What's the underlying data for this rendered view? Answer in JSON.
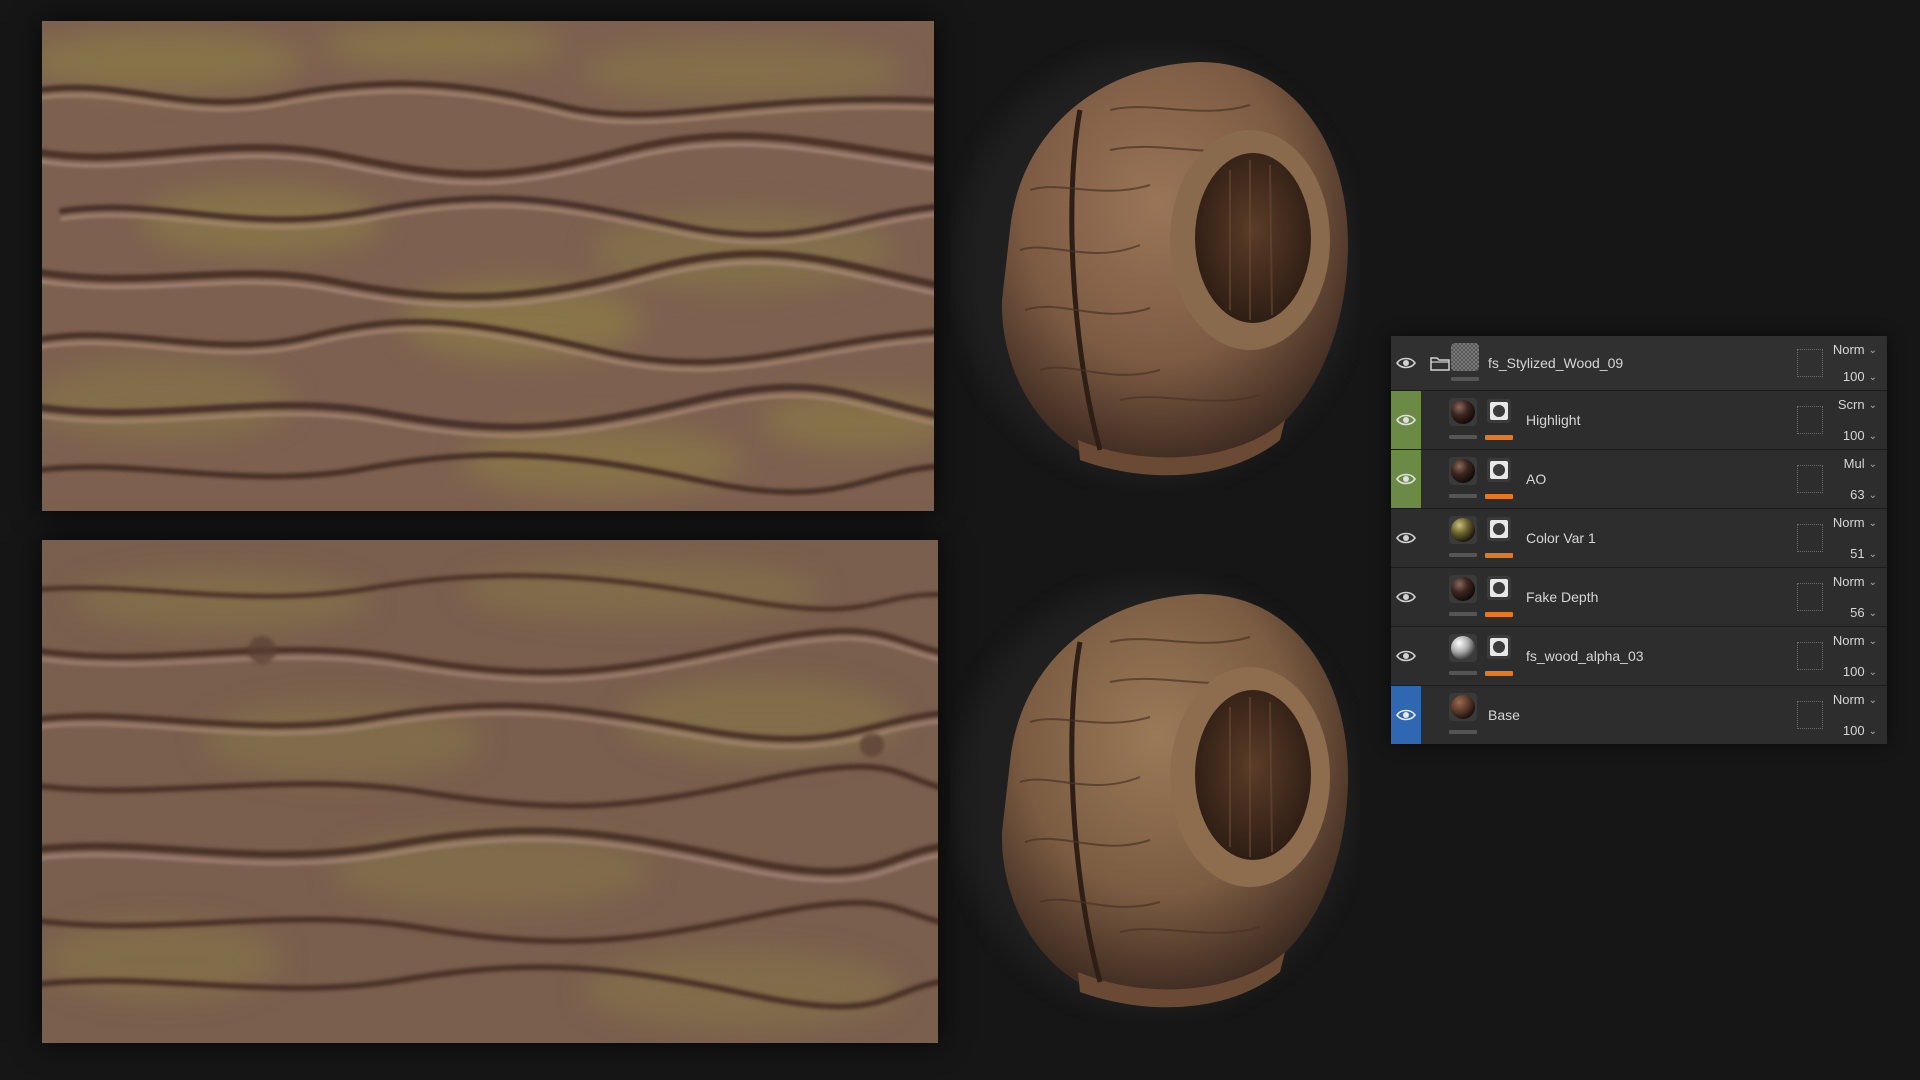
{
  "colors": {
    "panel_bg": "#2d2d2d",
    "active_green": "#6b8a45",
    "active_blue": "#2f67b3",
    "mask_bar_orange": "#e8761a",
    "wood_base": "#7b5f4f",
    "moss": "#7f7a3c"
  },
  "layers": [
    {
      "name": "fs_Stylized_Wood_09",
      "blend": "Norm",
      "opacity": "100",
      "type": "folder",
      "strip": "none",
      "thumb": "checker",
      "has_mask": false
    },
    {
      "name": "Highlight",
      "blend": "Scrn",
      "opacity": "100",
      "type": "fill",
      "strip": "green",
      "thumb": "dark-sphere",
      "has_mask": true
    },
    {
      "name": "AO",
      "blend": "Mul",
      "opacity": "63",
      "type": "fill",
      "strip": "green",
      "thumb": "dark-sphere",
      "has_mask": true
    },
    {
      "name": "Color Var 1",
      "blend": "Norm",
      "opacity": "51",
      "type": "fill",
      "strip": "none",
      "thumb": "olive-sphere",
      "has_mask": true
    },
    {
      "name": "Fake Depth",
      "blend": "Norm",
      "opacity": "56",
      "type": "fill",
      "strip": "none",
      "thumb": "dark-sphere",
      "has_mask": true
    },
    {
      "name": "fs_wood_alpha_03",
      "blend": "Norm",
      "opacity": "100",
      "type": "fill",
      "strip": "none",
      "thumb": "white-sphere",
      "has_mask": true
    },
    {
      "name": "Base",
      "blend": "Norm",
      "opacity": "100",
      "type": "fill",
      "strip": "blue",
      "thumb": "brown-sphere",
      "has_mask": false
    }
  ],
  "icons": {
    "visibility": "eye-icon",
    "folder": "folder-icon",
    "mask": "mask-icon",
    "dropdown": "chevron-down-icon"
  }
}
